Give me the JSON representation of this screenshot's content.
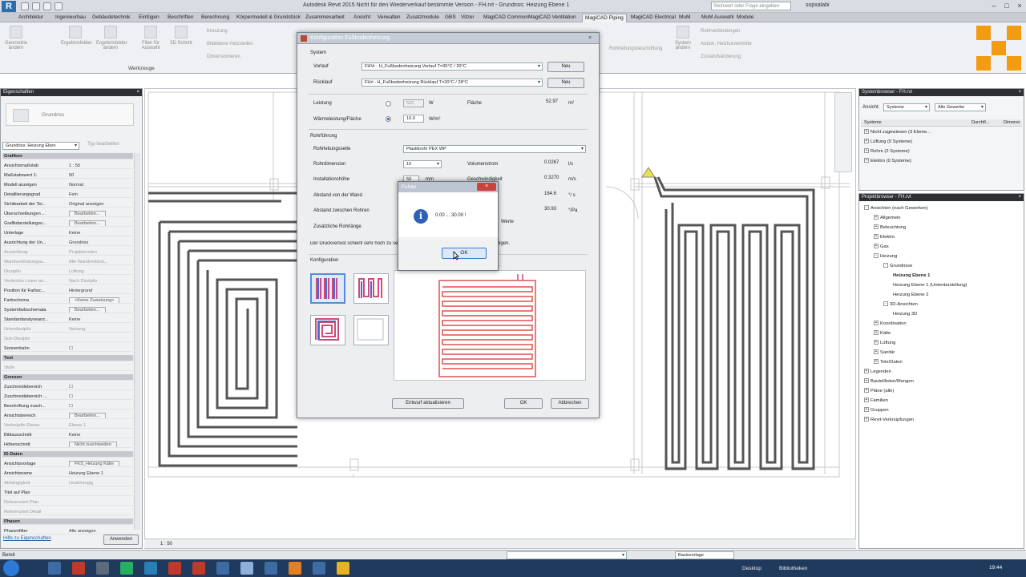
{
  "titlebar": {
    "title": "Autodesk Revit 2015 Nicht für den Wiederverkauf bestimmte Version - FH.rvt - Grundriss: Heizung Ebene 1",
    "search_placeholder": "Stichwort oder Frage eingeben",
    "user": "sopxalabi"
  },
  "tabs": [
    "Architektur",
    "Ingenieurbau",
    "Gebäudetechnik",
    "Einfügen",
    "Beschriften",
    "Berechnung",
    "Körpermodell & Grundstück",
    "Zusammenarbeit",
    "Ansicht",
    "Verwalten",
    "Zusatzmodule",
    "GBS",
    "Vitzer",
    "MagiCAD Common",
    "MagiCAD Ventilation",
    "MagiCAD Piping",
    "MagiCAD Electrical",
    "MuM",
    "MuM Auswahl",
    "Module"
  ],
  "active_tab": "MagiCAD Piping",
  "ribbon": {
    "buttons": [
      "Geometrie ändern",
      "Ergebnisfelder",
      "Ergebnisfelder ändern",
      "Filter für Auswahl",
      "3D Schnitt"
    ],
    "small": [
      "Kreuzung",
      "Bildebene Heizstellen",
      "Dimensionieren"
    ],
    "right_small": [
      "Rohrverbindungen",
      "Autom. Heizkurvenmitte",
      "Zustandsänderung"
    ],
    "right_button": "System ändern",
    "group_label": "Werkzeuge",
    "mid_label": "Rohrleitungsbeschriftung"
  },
  "properties": {
    "header": "Eigenschaften",
    "type_name": "Grundriss",
    "selector": "Grundriss: Heizung Eben",
    "edit_type": "Typ bearbeiten",
    "rows": [
      {
        "k": "Grafiken",
        "v": "",
        "s": true
      },
      {
        "k": "Ansichtsmaßstab",
        "v": "1 : 50"
      },
      {
        "k": "Maßstabswert 1:",
        "v": "50"
      },
      {
        "k": "Modell anzeigen",
        "v": "Normal"
      },
      {
        "k": "Detaillierungsgrad",
        "v": "Fein"
      },
      {
        "k": "Sichtbarkeit der Tei...",
        "v": "Original anzeigen"
      },
      {
        "k": "Überschreibungen ...",
        "v": "Bearbeiten...",
        "b": true
      },
      {
        "k": "Grafikdarstellungso...",
        "v": "Bearbeiten...",
        "b": true
      },
      {
        "k": "Unterlage",
        "v": "Keine"
      },
      {
        "k": "Ausrichtung der Un...",
        "v": "Grundriss"
      },
      {
        "k": "Ausrichtung",
        "v": "Projektnorden",
        "d": true
      },
      {
        "k": "Wandverbindungsa...",
        "v": "Alle Wandverbind...",
        "d": true
      },
      {
        "k": "Disziplin",
        "v": "Lüftung",
        "d": true
      },
      {
        "k": "Verdeckte Linien an...",
        "v": "Nach Disziplin",
        "d": true
      },
      {
        "k": "Position für Farbsc...",
        "v": "Hintergrund"
      },
      {
        "k": "Farbschema",
        "v": "<Keine Zuweisung>",
        "b": true
      },
      {
        "k": "Systemfarbschemata",
        "v": "Bearbeiten...",
        "b": true
      },
      {
        "k": "Standardanalyseanz...",
        "v": "Keine"
      },
      {
        "k": "Unterdisziplin",
        "v": "Heizung",
        "d": true
      },
      {
        "k": "Sub-Disziplin",
        "v": "",
        "d": true
      },
      {
        "k": "Sonnenbahn",
        "v": "☐"
      },
      {
        "k": "Text",
        "v": "",
        "s": true
      },
      {
        "k": "Stufe",
        "v": "",
        "d": true
      },
      {
        "k": "Grenzen",
        "v": "",
        "s": true
      },
      {
        "k": "Zuschneidebereich",
        "v": "☐"
      },
      {
        "k": "Zuschneidebereich ...",
        "v": "☐"
      },
      {
        "k": "Beschriftung zusch...",
        "v": "☐"
      },
      {
        "k": "Ansichtsbereich",
        "v": "Bearbeiten...",
        "b": true
      },
      {
        "k": "Verknüpfte Ebene",
        "v": "Ebene 1",
        "d": true
      },
      {
        "k": "Bildausschnitt",
        "v": "Keine"
      },
      {
        "k": "Höhenschnitt",
        "v": "Nicht zuschneiden",
        "b": true
      },
      {
        "k": "ID-Daten",
        "v": "",
        "s": true
      },
      {
        "k": "Ansichtsvorlage",
        "v": "FKS_Heizung Kälte",
        "b": true
      },
      {
        "k": "Ansichtsname",
        "v": "Heizung Ebene 1"
      },
      {
        "k": "Abhängigkeit",
        "v": "Unabhängig",
        "d": true
      },
      {
        "k": "Titel auf Plan",
        "v": ""
      },
      {
        "k": "Referenziert Plan",
        "v": "",
        "d": true
      },
      {
        "k": "Referenziert Detail",
        "v": "",
        "d": true
      },
      {
        "k": "Phasen",
        "v": "",
        "s": true
      },
      {
        "k": "Phasenfilter",
        "v": "Alle anzeigen"
      }
    ],
    "help_link": "Hilfe zu Eigenschaften",
    "apply": "Anwenden"
  },
  "view_scale": "1 : 50",
  "system_browser": {
    "header": "Systembrowser - FH.rvt",
    "view_label": "Ansicht:",
    "view_value": "Systeme",
    "filter_value": "Alle Gewerke",
    "col1": "Systeme",
    "col2": "Durchfl...",
    "col3": "Dimensi",
    "items": [
      "Nicht zugewiesen (3 Eleme...",
      "Lüftung (0 Systeme)",
      "Rohre (2 Systeme)",
      "Elektro (0 Systeme)"
    ]
  },
  "project_browser": {
    "header": "Projektbrowser - FH.rvt",
    "items": [
      {
        "t": "Ansichten (nach Gewerken)",
        "l": 0,
        "pm": "-"
      },
      {
        "t": "Allgemein",
        "l": 1,
        "pm": "+"
      },
      {
        "t": "Beleuchtung",
        "l": 1,
        "pm": "+"
      },
      {
        "t": "Elektro",
        "l": 1,
        "pm": "+"
      },
      {
        "t": "Gas",
        "l": 1,
        "pm": "+"
      },
      {
        "t": "Heizung",
        "l": 1,
        "pm": "-"
      },
      {
        "t": "Grundrisse",
        "l": 2,
        "pm": "-"
      },
      {
        "t": "Heizung Ebene 1",
        "l": 3,
        "b": true
      },
      {
        "t": "Heizung Ebene 1 (Unterdarstellung)",
        "l": 3
      },
      {
        "t": "Heizung Ebene 2",
        "l": 3
      },
      {
        "t": "3D-Ansichten",
        "l": 2,
        "pm": "-"
      },
      {
        "t": "Heizung 3D",
        "l": 3
      },
      {
        "t": "Koordination",
        "l": 1,
        "pm": "+"
      },
      {
        "t": "Kälte",
        "l": 1,
        "pm": "+"
      },
      {
        "t": "Lüftung",
        "l": 1,
        "pm": "+"
      },
      {
        "t": "Sanitär",
        "l": 1,
        "pm": "+"
      },
      {
        "t": "Tele/Daten",
        "l": 1,
        "pm": "+"
      },
      {
        "t": "Legenden",
        "l": 0,
        "pm": "+"
      },
      {
        "t": "Bauteillisten/Mengen",
        "l": 0,
        "pm": "+"
      },
      {
        "t": "Pläne (alle)",
        "l": 0,
        "pm": "+"
      },
      {
        "t": "Familien",
        "l": 0,
        "pm": "+"
      },
      {
        "t": "Gruppen",
        "l": 0,
        "pm": "+"
      },
      {
        "t": "Revit-Verknüpfungen",
        "l": 0,
        "pm": "+"
      }
    ]
  },
  "status": {
    "left": "Bereit",
    "filter": "Basisvorlage"
  },
  "taskbar": {
    "desktop": "Desktop",
    "libs": "Bibliotheken",
    "time": "19:44"
  },
  "dialog": {
    "title": "Konfiguration Fußbodenheizung",
    "section_system": "System",
    "vorlauf_label": "Vorlauf",
    "vorlauf_value": "FHVr - H_Fußbodenheizung Vorlauf T=35°C / 20°C",
    "ruecklauf_label": "Rücklauf",
    "ruecklauf_value": "FHrl - H_Fußbodenheizung Rücklauf T=20°C / 28°C",
    "new_label": "Neu",
    "leistung_label": "Leistung",
    "leistung_value": "520",
    "leistung_unit": "W",
    "waerme_label": "Wärmeleistung/Fläche",
    "waerme_value": "10.0",
    "waerme_unit": "W/m²",
    "flaeche_label": "Fläche",
    "flaeche_value": "52.97",
    "flaeche_unit": "m²",
    "section_rohr": "Rohrführung",
    "rohrtyp_label": "Rohrleitungsseite",
    "rohrtyp_value": "Plastikrohr PEX WP",
    "dim_label": "Rohrdimension",
    "dim_value": "10",
    "inst_label": "Installationshöhe",
    "inst_value": "50",
    "inst_unit": "mm",
    "abst_wand_label": "Abstand von der Wand",
    "abst_rohr_label": "Abstand zwischen Rohren",
    "zus_label": "Zusätzliche Rohrlänge",
    "vol_label": "Volumenstrom",
    "vol_value": "0.0267",
    "vol_unit": "l/s",
    "gesch_label": "Geschwindigkeit",
    "gesch_value": "0.3270",
    "gesch_unit": "m/s",
    "v3_value": "164.6",
    "v3_unit": "°/ s",
    "v4_value": "30.93",
    "v4_unit": "°/Pa",
    "werte_label": "Werte",
    "hinweis": "Der Druckverlust scheint sehr hoch zu sein. Überprüfen Sie die Dimensionen berücksichtigen.",
    "section_konfig": "Konfiguration",
    "btn_update": "Entwurf aktualisieren",
    "btn_ok": "OK",
    "btn_cancel": "Abbrechen"
  },
  "msgbox": {
    "title": "Fehler",
    "text": "0.00 ... 30.00 !",
    "ok": "OK"
  }
}
